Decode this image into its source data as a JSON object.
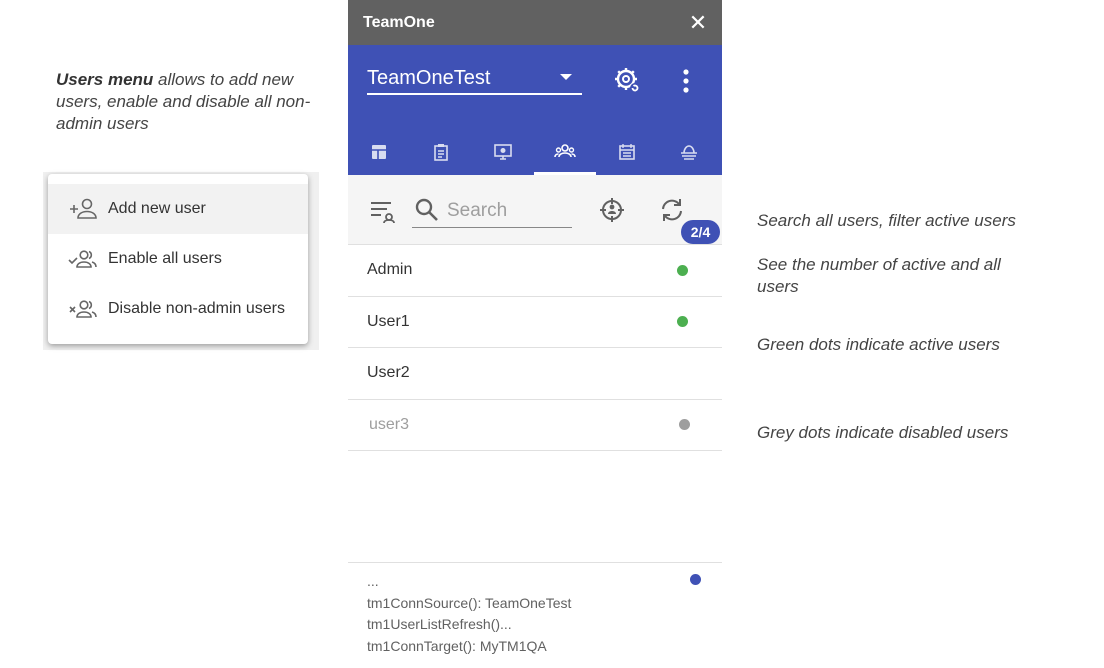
{
  "annotations": {
    "users_menu_bold": "Users menu",
    "users_menu_rest": " allows to add new users, enable and disable all non-admin users",
    "search": "Search all users, filter active users",
    "count": "See the number of active and all users",
    "green": "Green dots indicate active users",
    "grey": "Grey dots indicate disabled users"
  },
  "menu": {
    "items": [
      {
        "label": "Add new user",
        "icon": "person-add-icon"
      },
      {
        "label": "Enable all users",
        "icon": "people-check-icon"
      },
      {
        "label": "Disable non-admin users",
        "icon": "people-remove-icon"
      }
    ]
  },
  "panel": {
    "title": "TeamOne",
    "close_glyph": "✕",
    "connection": "TeamOneTest",
    "tabs": [
      "dashboard-icon",
      "clipboard-icon",
      "monitor-icon",
      "users-icon",
      "calendar-icon",
      "hat-icon"
    ],
    "active_tab": 3,
    "search": {
      "placeholder": "Search"
    },
    "badge": "2/4",
    "users": [
      {
        "name": "Admin",
        "status": "active"
      },
      {
        "name": "User1",
        "status": "active"
      },
      {
        "name": "User2",
        "status": "none"
      },
      {
        "name": "user3",
        "status": "disabled"
      }
    ],
    "log": [
      "...",
      "tm1ConnSource(): TeamOneTest",
      "tm1UserListRefresh()...",
      "tm1ConnTarget(): MyTM1QA"
    ]
  },
  "colors": {
    "accent": "#3f51b5",
    "titlebar": "#616161",
    "active": "#4caf50",
    "disabled": "#9e9e9e"
  }
}
